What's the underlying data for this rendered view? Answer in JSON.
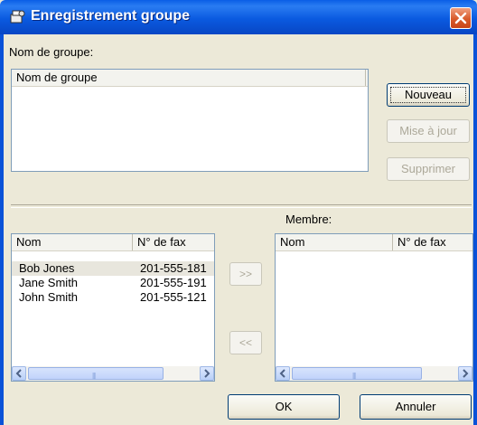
{
  "window": {
    "title": "Enregistrement groupe"
  },
  "group_section": {
    "label": "Nom de groupe:",
    "list_header": "Nom de groupe",
    "groups": []
  },
  "buttons": {
    "new": "Nouveau",
    "update": "Mise à jour",
    "delete": "Supprimer",
    "add": ">>",
    "remove": "<<",
    "ok": "OK",
    "cancel": "Annuler"
  },
  "contacts": {
    "columns": [
      "Nom",
      "N° de fax"
    ],
    "rows": [
      {
        "name": "Bob Jones",
        "fax": "201-555-181"
      },
      {
        "name": "Jane Smith",
        "fax": "201-555-191"
      },
      {
        "name": "John Smith",
        "fax": "201-555-121"
      }
    ]
  },
  "members": {
    "label": "Membre:",
    "columns": [
      "Nom",
      "N° de fax"
    ],
    "rows": []
  },
  "colors": {
    "titlebar": "#0a5ae0",
    "dialog_bg": "#ece9d8",
    "close_button": "#d85a2a"
  }
}
